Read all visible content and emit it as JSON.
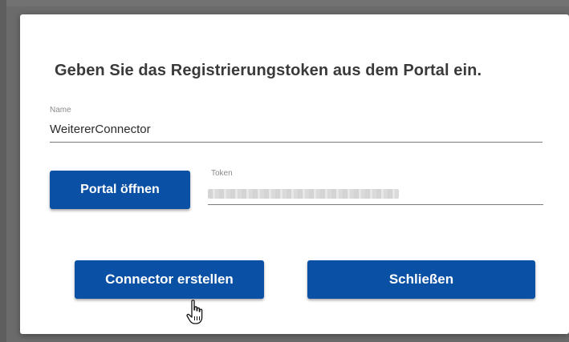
{
  "dialog": {
    "heading": "Geben Sie das Registrierungstoken aus dem Portal ein.",
    "name_field": {
      "label": "Name",
      "value": "WeitererConnector"
    },
    "token_field": {
      "label": "Token",
      "value": ""
    },
    "buttons": {
      "open_portal": "Portal öffnen",
      "create_connector": "Connector erstellen",
      "close": "Schließen"
    }
  },
  "colors": {
    "button_background": "#0a51a6",
    "button_text": "#ffffff",
    "backdrop": "#6b6b6b"
  },
  "icons": {
    "cursor": "hand-pointer-icon"
  }
}
